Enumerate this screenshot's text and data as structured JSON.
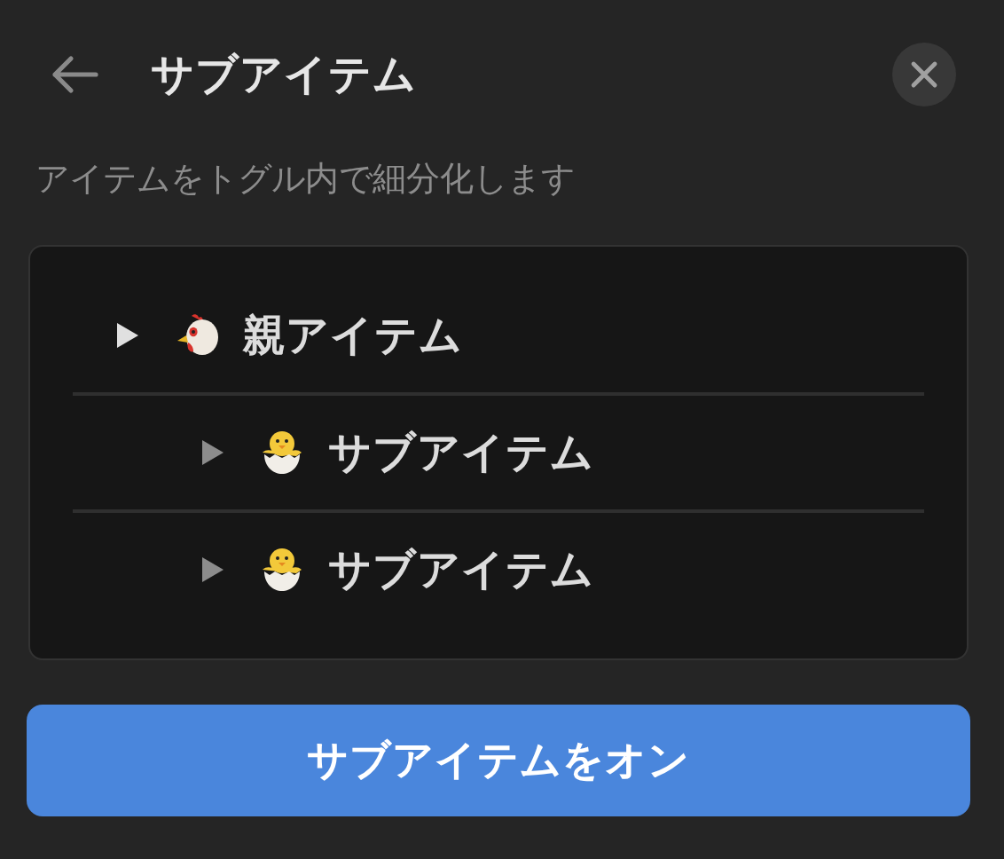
{
  "header": {
    "title": "サブアイテム",
    "description": "アイテムをトグル内で細分化します"
  },
  "tree": [
    {
      "label": "親アイテム",
      "children": [
        {
          "label": "サブアイテム"
        },
        {
          "label": "サブアイテム"
        }
      ]
    }
  ],
  "button": {
    "label": "サブアイテムをオン"
  }
}
